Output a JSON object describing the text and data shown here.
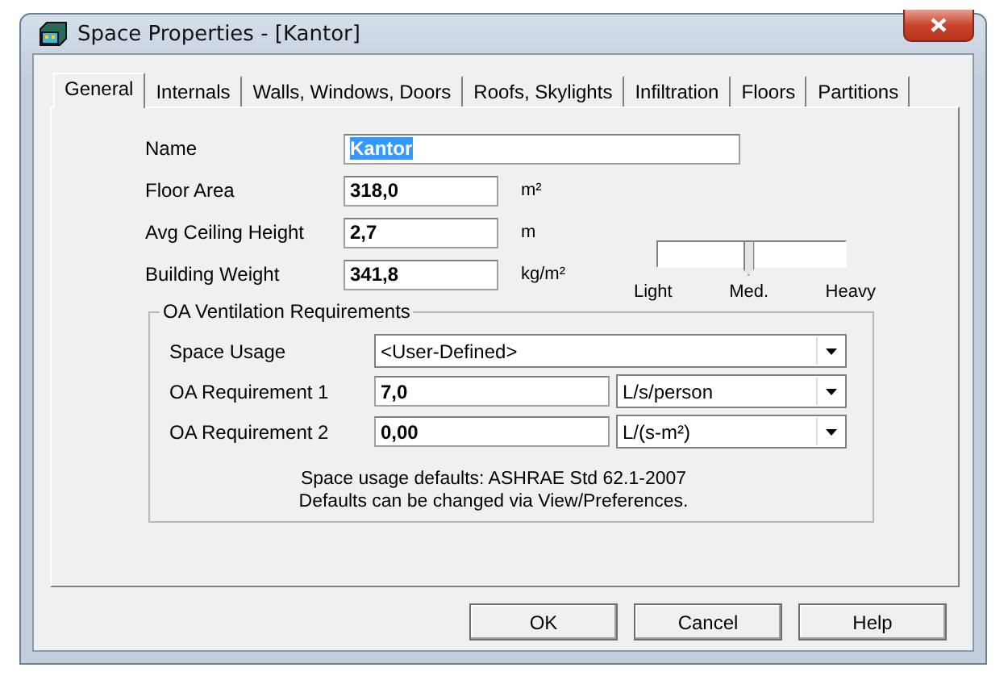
{
  "window": {
    "title": "Space Properties - [Kantor]"
  },
  "tabs": [
    {
      "label": "General",
      "selected": true
    },
    {
      "label": "Internals",
      "selected": false
    },
    {
      "label": "Walls, Windows, Doors",
      "selected": false
    },
    {
      "label": "Roofs, Skylights",
      "selected": false
    },
    {
      "label": "Infiltration",
      "selected": false
    },
    {
      "label": "Floors",
      "selected": false
    },
    {
      "label": "Partitions",
      "selected": false
    }
  ],
  "fields": [
    {
      "label": "Name",
      "value": "Kantor",
      "kind": "wide",
      "highlighted": true
    },
    {
      "label": "Floor Area",
      "value": "318,0",
      "unit": "m²",
      "kind": "short",
      "highlighted": false
    },
    {
      "label": "Avg Ceiling Height",
      "value": "2,7",
      "unit": "m",
      "kind": "short",
      "highlighted": false
    },
    {
      "label": "Building Weight",
      "value": "341,8",
      "unit": "kg/m²",
      "kind": "short",
      "highlighted": false
    }
  ],
  "weight_slider": {
    "level": 0.48,
    "labels": [
      "Light",
      "Med.",
      "Heavy"
    ]
  },
  "ventilation": {
    "title": "OA Ventilation Requirements",
    "rows": [
      {
        "label": "Space Usage",
        "kind": "select",
        "value": "<User-Defined>"
      },
      {
        "label": "OA Requirement 1",
        "kind": "input-select",
        "value": "7,0",
        "unit": "L/s/person"
      },
      {
        "label": "OA Requirement 2",
        "kind": "input-select",
        "value": "0,00",
        "unit": "L/(s-m²)"
      }
    ],
    "notes": [
      "Space usage defaults: ASHRAE Std 62.1-2007",
      "Defaults can be changed via View/Preferences."
    ]
  },
  "buttons": [
    {
      "label": "OK"
    },
    {
      "label": "Cancel"
    },
    {
      "label": "Help"
    }
  ]
}
